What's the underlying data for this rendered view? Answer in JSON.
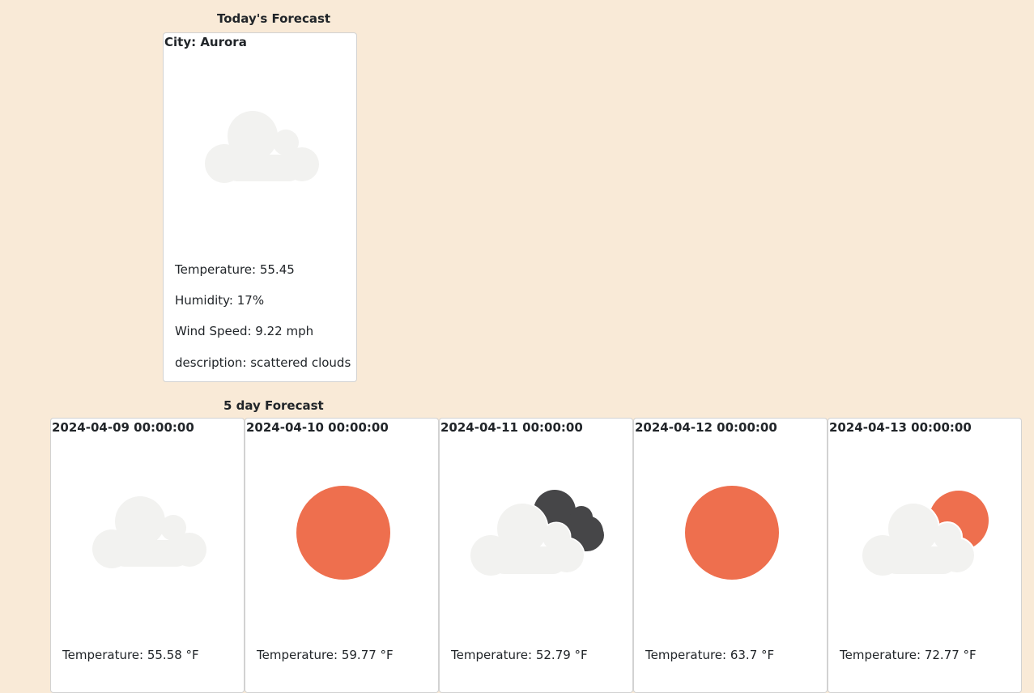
{
  "today": {
    "heading": "Today's Forecast",
    "city_label": "City: Aurora",
    "icon": "scattered-clouds-icon",
    "lines": [
      "Temperature: 55.45",
      "Humidity: 17%",
      "Wind Speed: 9.22 mph",
      "description: scattered clouds"
    ]
  },
  "forecast": {
    "heading": "5 day Forecast",
    "days": [
      {
        "date": "2024-04-09 00:00:00",
        "icon": "cloud-icon",
        "temperature": "Temperature: 55.58 °F"
      },
      {
        "date": "2024-04-10 00:00:00",
        "icon": "sun-icon",
        "temperature": "Temperature: 59.77 °F"
      },
      {
        "date": "2024-04-11 00:00:00",
        "icon": "broken-clouds-icon",
        "temperature": "Temperature: 52.79 °F"
      },
      {
        "date": "2024-04-12 00:00:00",
        "icon": "sun-icon",
        "temperature": "Temperature: 63.7 °F"
      },
      {
        "date": "2024-04-13 00:00:00",
        "icon": "partly-cloudy-icon",
        "temperature": "Temperature: 72.77 °F"
      }
    ]
  },
  "colors": {
    "page_background": "#f9ead7",
    "cloud_light": "#f2f2f0",
    "cloud_dark": "#464648",
    "sun": "#ee6f4e"
  }
}
